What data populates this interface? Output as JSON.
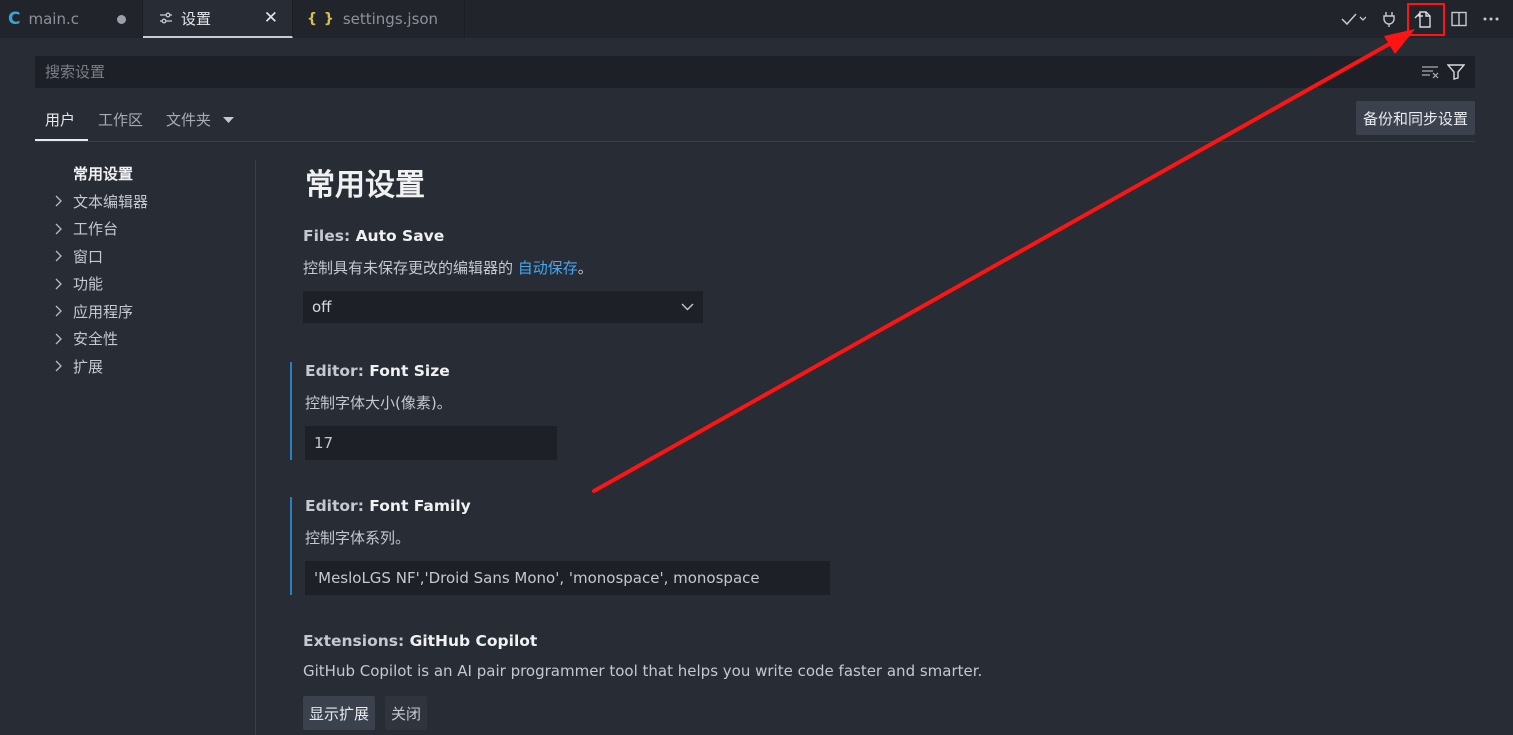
{
  "tabs": [
    {
      "label": "main.c",
      "icon": "c-language-icon",
      "icon_glyph": "C",
      "dirty": true
    },
    {
      "label": "设置",
      "icon": "settings-sliders-icon",
      "close": "✕"
    },
    {
      "label": "settings.json",
      "icon": "json-braces-icon",
      "icon_glyph": "{ }"
    }
  ],
  "search": {
    "placeholder": "搜索设置"
  },
  "scope": {
    "user": "用户",
    "workspace": "工作区",
    "folder": "文件夹",
    "backup_button": "备份和同步设置"
  },
  "toc": {
    "items": [
      {
        "label": "常用设置",
        "expandable": false
      },
      {
        "label": "文本编辑器",
        "expandable": true
      },
      {
        "label": "工作台",
        "expandable": true
      },
      {
        "label": "窗口",
        "expandable": true
      },
      {
        "label": "功能",
        "expandable": true
      },
      {
        "label": "应用程序",
        "expandable": true
      },
      {
        "label": "安全性",
        "expandable": true
      },
      {
        "label": "扩展",
        "expandable": true
      }
    ]
  },
  "content": {
    "section_title": "常用设置",
    "auto_save": {
      "category": "Files: ",
      "name": "Auto Save",
      "desc_prefix": "控制具有未保存更改的编辑器的 ",
      "desc_link": "自动保存",
      "desc_suffix": "。",
      "value": "off"
    },
    "font_size": {
      "category": "Editor: ",
      "name": "Font Size",
      "desc": "控制字体大小(像素)。",
      "value": "17"
    },
    "font_family": {
      "category": "Editor: ",
      "name": "Font Family",
      "desc": "控制字体系列。",
      "value": "'MesloLGS NF','Droid Sans Mono', 'monospace', monospace"
    },
    "copilot": {
      "category": "Extensions: ",
      "name": "GitHub Copilot",
      "desc": "GitHub Copilot is an AI pair programmer tool that helps you write code faster and smarter.",
      "show_button": "显示扩展",
      "close_button": "关闭"
    }
  },
  "colors": {
    "background": "#282c34",
    "tabbar": "#21252b",
    "input_bg": "#1d2026",
    "link": "#4aa5f0",
    "modified_indicator": "#2b7fb8",
    "annotation_red": "#ff1414"
  }
}
